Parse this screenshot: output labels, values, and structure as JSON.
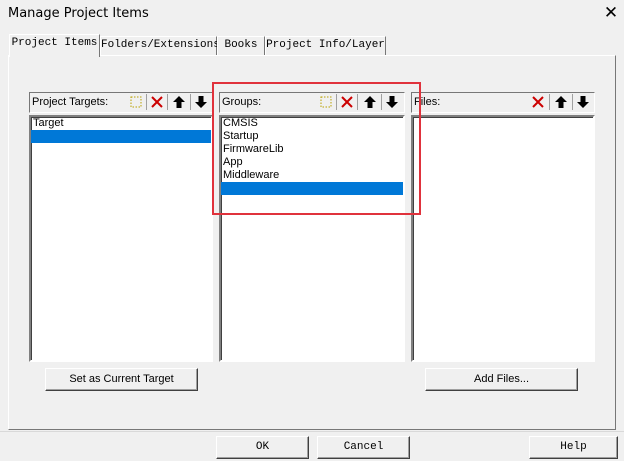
{
  "window": {
    "title": "Manage Project Items",
    "close_glyph": "✕"
  },
  "tabs": [
    {
      "label": "Project Items",
      "active": true
    },
    {
      "label": "Folders/Extensions",
      "active": false
    },
    {
      "label": "Books",
      "active": false
    },
    {
      "label": "Project Info/Layer",
      "active": false
    }
  ],
  "targets": {
    "label": "Project Targets:",
    "items": [
      "Target",
      ""
    ],
    "selected_index": 1,
    "button": "Set as Current Target",
    "toolbar": [
      "new-icon",
      "delete-icon",
      "move-up-icon",
      "move-down-icon"
    ]
  },
  "groups": {
    "label": "Groups:",
    "items": [
      "CMSIS",
      "Startup",
      "FirmwareLib",
      "App",
      "Middleware",
      ""
    ],
    "selected_index": 5,
    "toolbar": [
      "new-icon",
      "delete-icon",
      "move-up-icon",
      "move-down-icon"
    ]
  },
  "files": {
    "label": "Files:",
    "items": [],
    "button": "Add Files...",
    "toolbar": [
      "delete-icon",
      "move-up-icon",
      "move-down-icon"
    ]
  },
  "footer": {
    "ok": "OK",
    "cancel": "Cancel",
    "help": "Help"
  },
  "colors": {
    "selection": "#0078d7",
    "highlight_box": "#e0323c",
    "delete_icon": "#cc0000"
  }
}
